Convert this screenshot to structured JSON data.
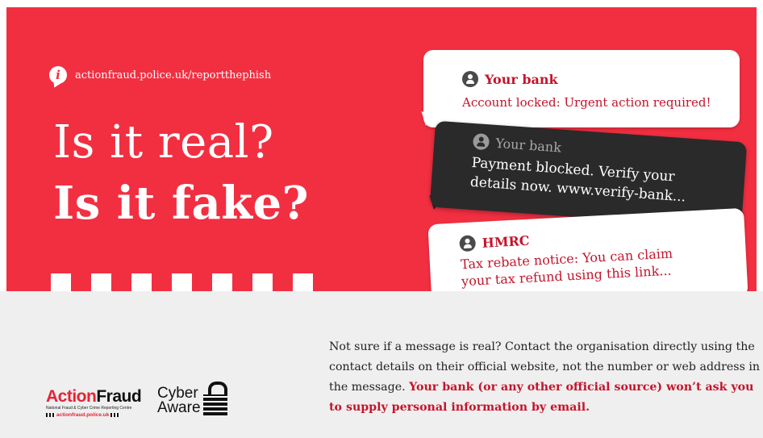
{
  "hero": {
    "url": "actionfraud.police.uk/reportthephish",
    "headline_line1": "Is it real?",
    "headline_line2": "Is it fake?",
    "background_color": "#f22f41"
  },
  "messages": [
    {
      "sender": "Your bank",
      "text": "Account locked: Urgent action required!"
    },
    {
      "sender": "Your bank",
      "text_line1": "Payment blocked. Verify your",
      "text_line2": "details now. www.verify-bank..."
    },
    {
      "sender": "HMRC",
      "text_line1": "Tax rebate notice: You can claim",
      "text_line2": "your tax refund using this link..."
    }
  ],
  "footer": {
    "advice_plain": "Not sure if a message is real? Contact the organisation directly using the contact details on their official website, not the number or web address in the message. ",
    "advice_emphasis": "Your bank (or any other official source) won’t ask you to supply personal information by email."
  },
  "logos": {
    "action_fraud": {
      "part1": "Action",
      "part2": "Fraud",
      "subtitle": "National Fraud & Cyber Crime Reporting Centre",
      "url": "actionfraud.police.uk"
    },
    "cyber_aware": {
      "line1": "Cyber",
      "line2": "Aware"
    }
  },
  "colors": {
    "accent_red": "#c4142b",
    "dark_bubble": "#2a2a2a",
    "footer_bg": "#efefef"
  }
}
